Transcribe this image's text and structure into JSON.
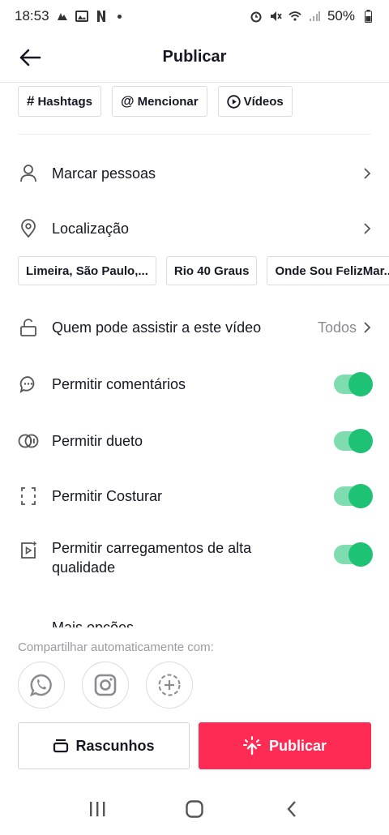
{
  "status_bar": {
    "time": "18:53",
    "battery": "50%",
    "left_icons": [
      "notification-icon",
      "gallery-icon",
      "netflix-icon"
    ],
    "right_icons": [
      "alarm-icon",
      "mute-icon",
      "wifi-icon",
      "signal-icon",
      "battery-icon"
    ]
  },
  "header": {
    "title": "Publicar"
  },
  "tags": [
    {
      "icon": "#",
      "label": "Hashtags"
    },
    {
      "icon": "@",
      "label": "Mencionar"
    },
    {
      "icon": "play-circle-icon",
      "label": "Vídeos"
    }
  ],
  "settings": {
    "tag_people": {
      "label": "Marcar pessoas"
    },
    "location": {
      "label": "Localização"
    },
    "location_suggestions": [
      "Limeira, São Paulo,...",
      "Rio 40 Graus",
      "Onde Sou FelizMar..."
    ],
    "privacy": {
      "label": "Quem pode assistir a este vídeo",
      "value": "Todos"
    },
    "comments": {
      "label": "Permitir comentários",
      "enabled": true
    },
    "duet": {
      "label": "Permitir dueto",
      "enabled": true
    },
    "stitch": {
      "label": "Permitir Costurar",
      "enabled": true
    },
    "hq_upload": {
      "label": "Permitir carregamentos de alta qualidade",
      "enabled": true
    },
    "partial_row": {
      "label": "Mais opções"
    }
  },
  "share": {
    "label": "Compartilhar automaticamente com:",
    "targets": [
      "whatsapp-icon",
      "instagram-icon",
      "add-icon"
    ]
  },
  "actions": {
    "drafts": "Rascunhos",
    "publish": "Publicar"
  },
  "colors": {
    "accent": "#fe2c55",
    "toggle_on": "#1ec274",
    "toggle_track": "#7fdcb0"
  },
  "nav": [
    "recents-icon",
    "home-icon",
    "back-icon"
  ]
}
